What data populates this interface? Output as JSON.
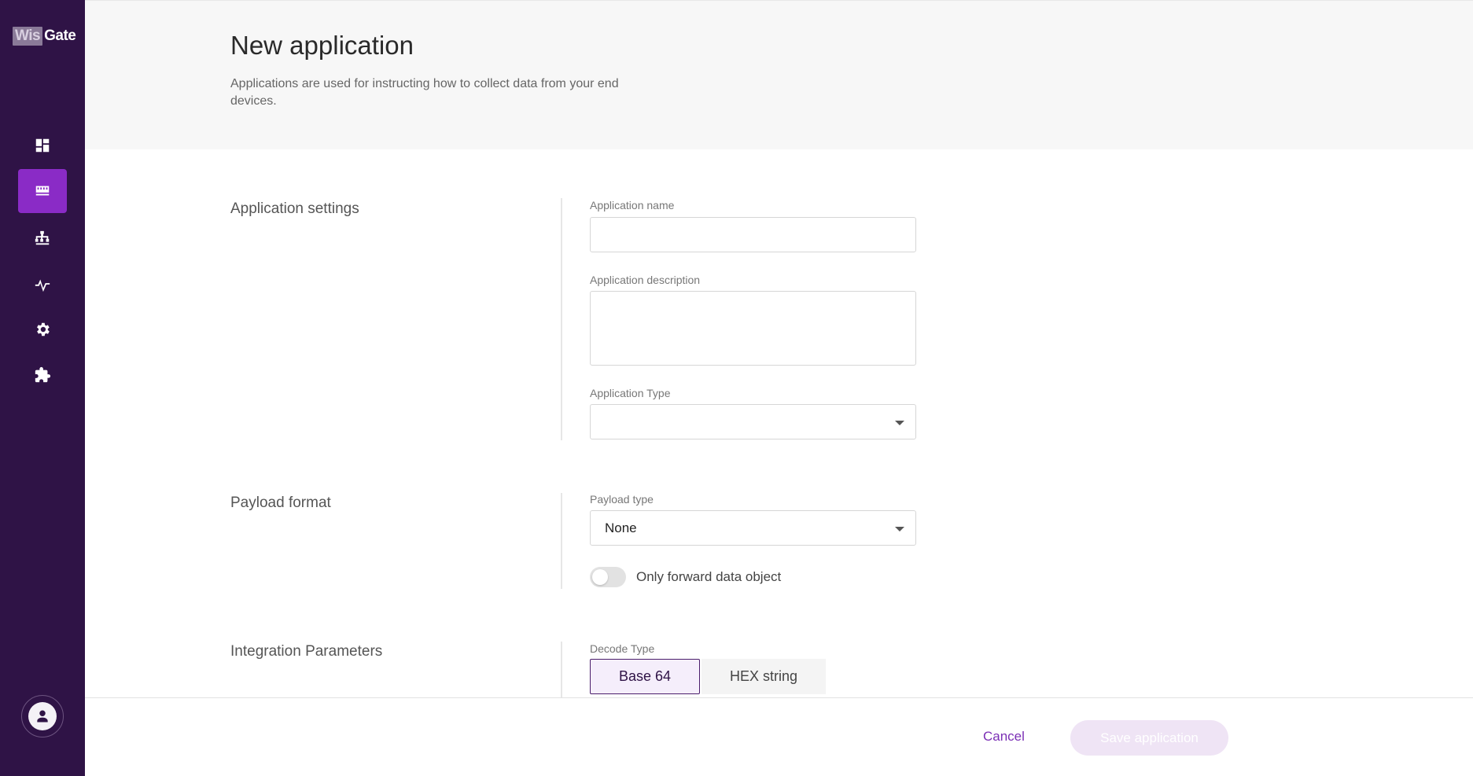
{
  "brand": {
    "logo_part1": "Wis",
    "logo_part2": "Gate"
  },
  "sidebar": {
    "items": [
      {
        "name": "dashboard",
        "icon": "dashboard-icon"
      },
      {
        "name": "applications",
        "icon": "applications-icon",
        "active": true
      },
      {
        "name": "network",
        "icon": "network-icon"
      },
      {
        "name": "activity",
        "icon": "activity-icon"
      },
      {
        "name": "settings",
        "icon": "gear-icon"
      },
      {
        "name": "integrations",
        "icon": "puzzle-icon"
      }
    ],
    "avatar_icon": "user-icon"
  },
  "header": {
    "title": "New application",
    "description": "Applications are used for instructing how to collect data from your end devices."
  },
  "sections": {
    "app_settings": {
      "label": "Application settings",
      "name_label": "Application name",
      "name_value": "",
      "description_label": "Application description",
      "description_value": "",
      "type_label": "Application Type",
      "type_value": ""
    },
    "payload": {
      "label": "Payload format",
      "type_label": "Payload type",
      "type_value": "None",
      "toggle_label": "Only forward data object",
      "toggle_on": false
    },
    "integration": {
      "label": "Integration Parameters",
      "decode_label": "Decode Type",
      "options": [
        "Base 64",
        "HEX string"
      ],
      "selected": "Base 64"
    }
  },
  "footer": {
    "cancel_label": "Cancel",
    "save_label": "Save application"
  },
  "colors": {
    "sidebar_bg": "#2f1346",
    "accent": "#8a2bc6",
    "cancel_link": "#7b2fb5",
    "save_disabled_bg": "#efe4f5"
  }
}
